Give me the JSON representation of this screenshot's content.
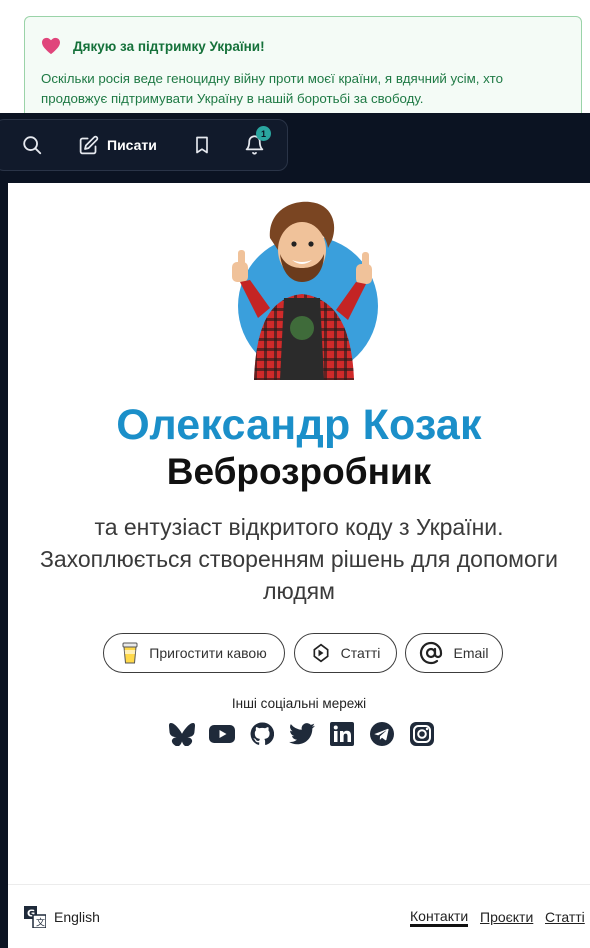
{
  "banner": {
    "title": "Дякую за підтримку України!",
    "text": "Оскільки росія веде геноцидну війну проти моєї країни, я вдячний усім, хто продовжує підтримувати Україну в нашій боротьбі за свободу.",
    "icon": "heart-icon",
    "accent": "#15713a"
  },
  "toolbar": {
    "search_icon": "search-icon",
    "write_label": "Писати",
    "bookmark_icon": "bookmark-icon",
    "notifications_count": "1"
  },
  "profile": {
    "name": "Олександр Козак",
    "role": "Веброзробник",
    "tagline": "та ентузіаст відкритого коду з України. Захоплюється створенням рішень для допомоги людям",
    "name_color": "#1b8fc9"
  },
  "actions": {
    "coffee_label": "Пригостити кавою",
    "articles_label": "Статті",
    "email_label": "Email"
  },
  "social": {
    "caption": "Інші соціальні мережі",
    "networks": [
      "bluesky-icon",
      "youtube-icon",
      "github-icon",
      "twitter-icon",
      "linkedin-icon",
      "telegram-icon",
      "instagram-icon"
    ]
  },
  "footer": {
    "language": "English",
    "links": [
      "Контакти",
      "Проєкти",
      "Статті"
    ]
  }
}
